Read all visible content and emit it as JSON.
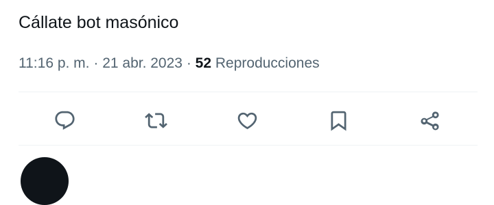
{
  "tweet": {
    "text": "Cállate bot masónico",
    "time": "11:16 p. m.",
    "separator": "·",
    "date": "21 abr. 2023",
    "views_count": "52",
    "views_label": "Reproducciones"
  },
  "actions": {
    "reply_icon": "speech-bubble-icon",
    "retweet_icon": "retweet-arrows-icon",
    "like_icon": "heart-icon",
    "bookmark_icon": "bookmark-icon",
    "share_icon": "share-nodes-icon"
  },
  "colors": {
    "text_primary": "#0f1419",
    "text_secondary": "#536471",
    "divider": "#eff3f4"
  }
}
